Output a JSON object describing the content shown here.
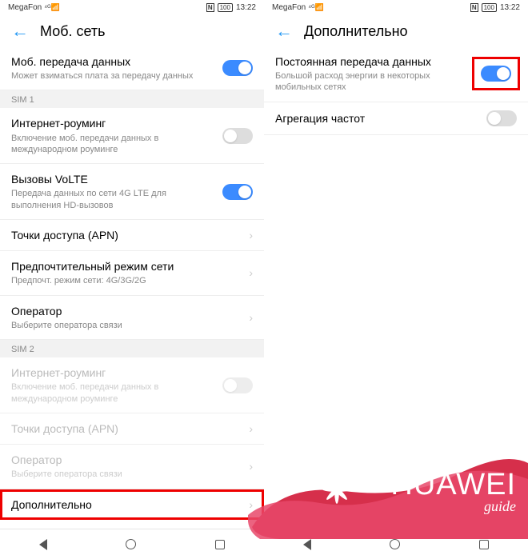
{
  "status": {
    "carrier": "MegaFon",
    "signal": "⁴ᴳ📶",
    "nfc": "N",
    "battery": "100",
    "time": "13:22"
  },
  "left": {
    "title": "Моб. сеть",
    "rows": {
      "mobile_data": {
        "title": "Моб. передача данных",
        "sub": "Может взиматься плата за передачу данных"
      },
      "sim1_label": "SIM 1",
      "roaming": {
        "title": "Интернет-роуминг",
        "sub": "Включение моб. передачи данных в международном роуминге"
      },
      "volte": {
        "title": "Вызовы VoLTE",
        "sub": "Передача данных по сети 4G LTE для выполнения HD-вызовов"
      },
      "apn": {
        "title": "Точки доступа (APN)"
      },
      "netmode": {
        "title": "Предпочтительный режим сети",
        "sub": "Предпочт. режим сети: 4G/3G/2G"
      },
      "operator": {
        "title": "Оператор",
        "sub": "Выберите оператора связи"
      },
      "sim2_label": "SIM 2",
      "roaming2": {
        "title": "Интернет-роуминг",
        "sub": "Включение моб. передачи данных в международном роуминге"
      },
      "apn2": {
        "title": "Точки доступа (APN)"
      },
      "operator2": {
        "title": "Оператор",
        "sub": "Выберите оператора связи"
      },
      "advanced": {
        "title": "Дополнительно"
      }
    }
  },
  "right": {
    "title": "Дополнительно",
    "rows": {
      "always_on": {
        "title": "Постоянная передача данных",
        "sub": "Большой расход энергии в некоторых мобильных сетях"
      },
      "aggregation": {
        "title": "Агрегация частот"
      }
    }
  },
  "watermark": {
    "main": "HUAWEI",
    "sub": "guide"
  }
}
